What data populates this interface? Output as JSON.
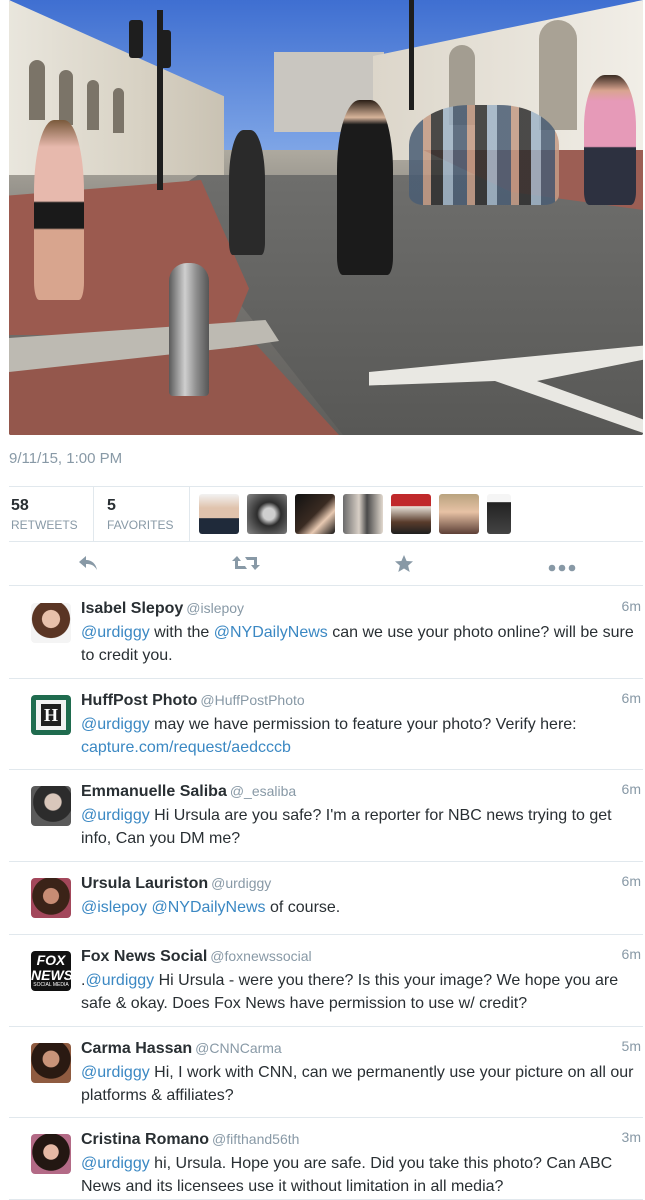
{
  "tweet": {
    "timestamp": "9/11/15, 1:00 PM",
    "retweets": {
      "count": "58",
      "label": "RETWEETS"
    },
    "favorites": {
      "count": "5",
      "label": "FAVORITES"
    }
  },
  "actions": {
    "reply_icon": "reply-icon",
    "retweet_icon": "retweet-icon",
    "favorite_icon": "star-icon",
    "more_icon": "more-dots-icon"
  },
  "colors": {
    "link": "#3b88c3",
    "muted": "#8899a6",
    "text": "#292f33",
    "divider": "#e1e8ed"
  },
  "replies": [
    {
      "name": "Isabel Slepoy",
      "handle": "@islepoy",
      "time": "6m",
      "segments": [
        {
          "t": "@urdiggy",
          "link": true
        },
        {
          "t": " with the ",
          "link": false
        },
        {
          "t": "@NYDailyNews",
          "link": true
        },
        {
          "t": " can we use your photo online? will be sure to credit you.",
          "link": false
        }
      ]
    },
    {
      "name": "HuffPost Photo",
      "handle": "@HuffPostPhoto",
      "time": "6m",
      "segments": [
        {
          "t": "@urdiggy",
          "link": true
        },
        {
          "t": " may we have permission to feature your photo? Verify here: ",
          "link": false
        },
        {
          "t": "capture.com/request/aedcccb",
          "link": true
        }
      ]
    },
    {
      "name": "Emmanuelle Saliba",
      "handle": "@_esaliba",
      "time": "6m",
      "segments": [
        {
          "t": "@urdiggy",
          "link": true
        },
        {
          "t": " Hi Ursula are you safe? I'm a reporter for NBC news trying to get info, Can you DM me?",
          "link": false
        }
      ]
    },
    {
      "name": "Ursula Lauriston",
      "handle": "@urdiggy",
      "time": "6m",
      "segments": [
        {
          "t": "@islepoy",
          "link": true
        },
        {
          "t": " ",
          "link": false
        },
        {
          "t": "@NYDailyNews",
          "link": true
        },
        {
          "t": " of course.",
          "link": false
        }
      ]
    },
    {
      "name": "Fox News Social",
      "handle": "@foxnewssocial",
      "time": "6m",
      "segments": [
        {
          "t": ".",
          "link": false
        },
        {
          "t": "@urdiggy",
          "link": true
        },
        {
          "t": " Hi Ursula - were you there? Is this your image? We hope you are safe & okay. Does Fox News have permission to use w/ credit?",
          "link": false
        }
      ]
    },
    {
      "name": "Carma Hassan",
      "handle": "@CNNCarma",
      "time": "5m",
      "segments": [
        {
          "t": "@urdiggy",
          "link": true
        },
        {
          "t": " Hi, I work with CNN, can we permanently use your picture on all our platforms & affiliates?",
          "link": false
        }
      ]
    },
    {
      "name": "Cristina Romano",
      "handle": "@fifthand56th",
      "time": "3m",
      "segments": [
        {
          "t": "@urdiggy",
          "link": true
        },
        {
          "t": " hi, Ursula. Hope you are safe. Did you take this photo? Can ABC News and its licensees use it without limitation in all media?",
          "link": false
        }
      ]
    }
  ]
}
